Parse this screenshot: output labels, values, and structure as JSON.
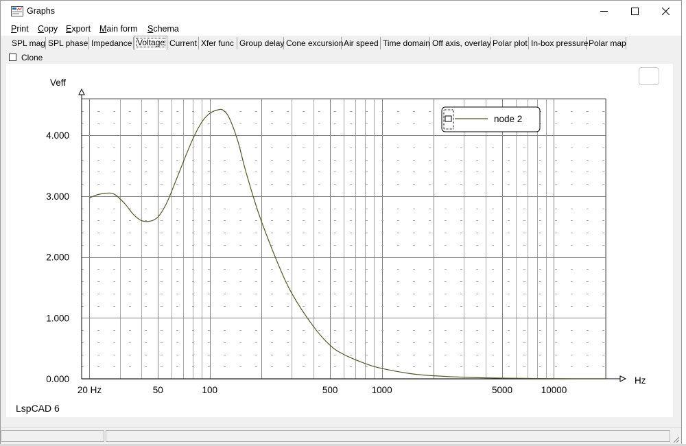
{
  "window": {
    "title": "Graphs",
    "menu": [
      "Print",
      "Copy",
      "Export",
      "Main form",
      "Schema"
    ]
  },
  "tabs": [
    "SPL mag",
    "SPL phase",
    "Impedance",
    "Voltage",
    "Current",
    "Xfer func",
    "Group delay",
    "Cone excursion",
    "Air speed",
    "Time domain",
    "Off axis, overlay",
    "Polar plot",
    "In-box pressure",
    "Polar map"
  ],
  "active_tab": "Voltage",
  "clone_checkbox": {
    "label": "Clone",
    "checked": false
  },
  "footer_label": "LspCAD 6",
  "colors": {
    "curve": "#55552a",
    "grid_major": "#808080",
    "grid_minor": "#a8a8a8"
  },
  "chart_data": {
    "type": "line",
    "title": "",
    "xlabel": "Hz",
    "ylabel": "Veff",
    "x_scale": "log",
    "xlim": [
      18,
      20000
    ],
    "ylim": [
      0,
      4.6
    ],
    "x_ticks": [
      20,
      50,
      100,
      500,
      1000,
      5000,
      10000
    ],
    "x_tick_labels": [
      "20 Hz",
      "50",
      "100",
      "500",
      "1000",
      "5000",
      "10000"
    ],
    "y_ticks": [
      0,
      1,
      2,
      3,
      4
    ],
    "y_tick_labels": [
      "0.000",
      "1.000",
      "2.000",
      "3.000",
      "4.000"
    ],
    "grid": true,
    "legend": {
      "position": "top-right",
      "entries": [
        "node 2"
      ]
    },
    "series": [
      {
        "name": "node 2",
        "x": [
          20,
          22,
          25,
          28,
          32,
          36,
          40,
          45,
          50,
          56,
          63,
          71,
          80,
          90,
          100,
          112,
          120,
          130,
          145,
          160,
          180,
          200,
          250,
          300,
          400,
          500,
          600,
          800,
          1000,
          1500,
          2000,
          3000,
          5000,
          10000,
          20000
        ],
        "y": [
          2.97,
          3.02,
          3.05,
          3.03,
          2.88,
          2.7,
          2.6,
          2.59,
          2.66,
          2.88,
          3.23,
          3.6,
          3.95,
          4.22,
          4.36,
          4.42,
          4.41,
          4.28,
          3.92,
          3.46,
          2.97,
          2.58,
          1.88,
          1.4,
          0.86,
          0.55,
          0.4,
          0.25,
          0.17,
          0.08,
          0.05,
          0.025,
          0.01,
          0.003,
          0.001
        ]
      }
    ]
  }
}
